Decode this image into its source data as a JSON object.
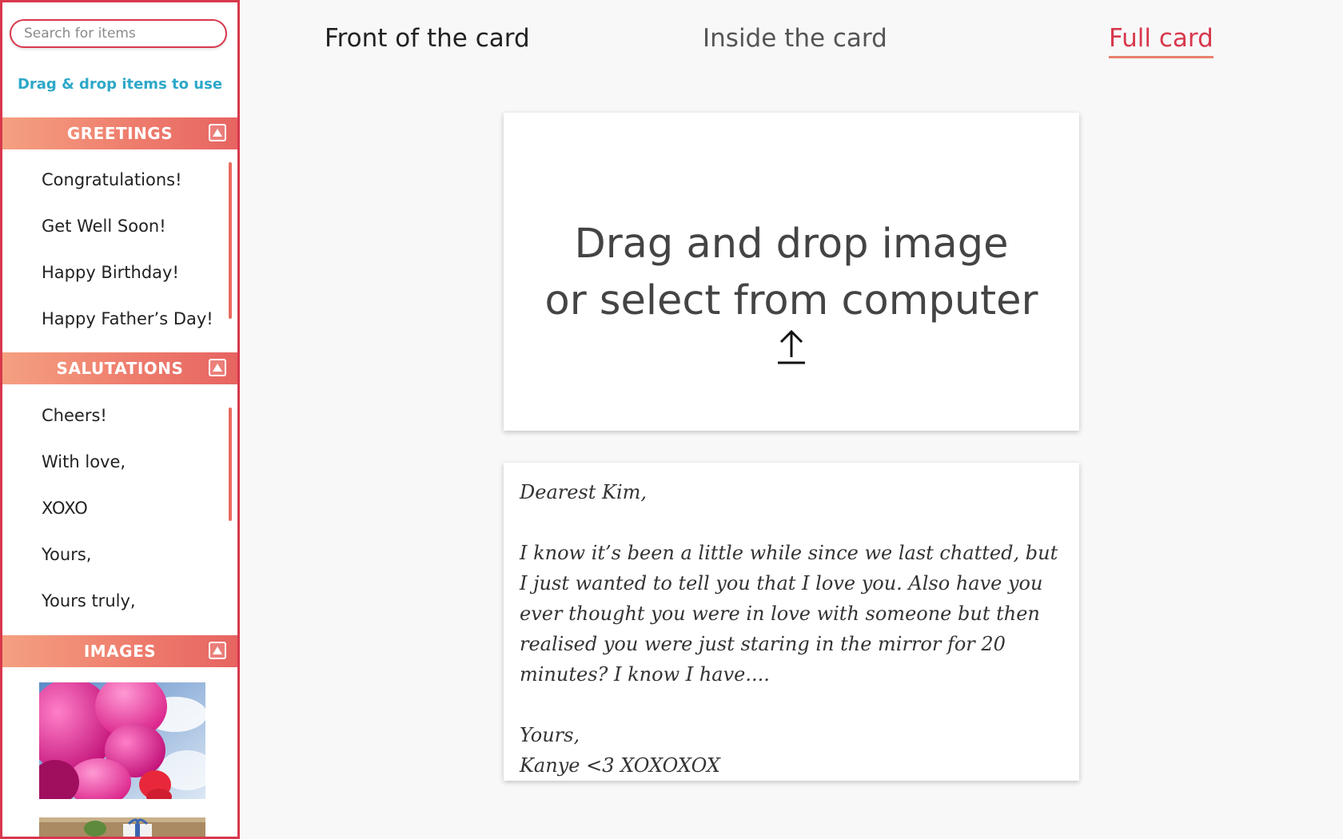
{
  "sidebar": {
    "search_placeholder": "Search for items",
    "drag_hint": "Drag & drop items to use",
    "sections": {
      "greetings": {
        "title": "GREETINGS",
        "items": [
          "Congratulations!",
          "Get Well Soon!",
          "Happy Birthday!",
          "Happy Father’s Day!"
        ]
      },
      "salutations": {
        "title": "SALUTATIONS",
        "items": [
          "Cheers!",
          "With love,",
          "XOXO",
          "Yours,",
          "Yours truly,"
        ]
      },
      "images": {
        "title": "IMAGES",
        "items": [
          "balloons-image",
          "gift-image"
        ]
      }
    }
  },
  "tabs": {
    "front": "Front of the card",
    "inside": "Inside the card",
    "full": "Full card",
    "active": "full"
  },
  "front_card": {
    "line1": "Drag and drop image",
    "line2": "or select from computer",
    "icon": "upload-icon"
  },
  "inside_card": {
    "greeting": "Dearest Kim,",
    "body": "I know it’s been a little while since we last chatted, but I just wanted to tell you that I love you. Also have you ever thought you were in love with someone but then realised you were just staring in the mirror for 20 minutes? I know I have....",
    "closing": "Yours,",
    "signature": "Kanye <3 XOXOXOX"
  },
  "colors": {
    "accent": "#d8384c",
    "hint": "#2ea8c8",
    "header_start": "#f5a081",
    "header_end": "#e76461"
  }
}
